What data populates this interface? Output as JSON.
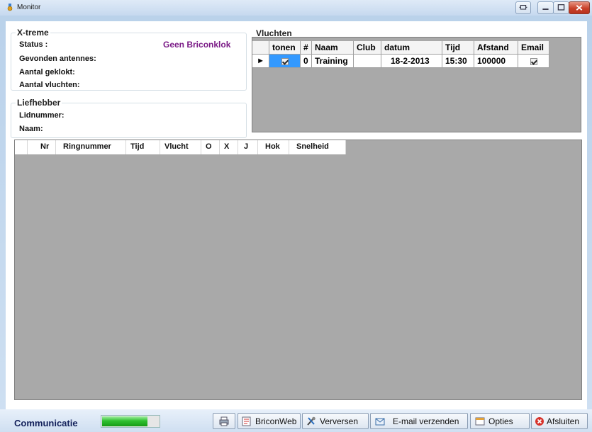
{
  "window": {
    "title": "Monitor"
  },
  "xtreme": {
    "title": "X-treme",
    "status_label": "Status :",
    "status_value": "Geen Briconklok",
    "antennas_label": "Gevonden antennes:",
    "clocked_label": "Aantal geklokt:",
    "flights_label": "Aantal vluchten:"
  },
  "liefhebber": {
    "title": "Liefhebber",
    "member_label": "Lidnummer:",
    "name_label": "Naam:"
  },
  "vluchten": {
    "title": "Vluchten",
    "columns": [
      "tonen",
      "#",
      "Naam",
      "Club",
      "datum",
      "Tijd",
      "Afstand",
      "Email"
    ],
    "rows": [
      {
        "tonen": true,
        "nr": "0",
        "naam": "Training",
        "club": "",
        "datum": "18-2-2013",
        "tijd": "15:30",
        "afstand": "100000",
        "email": true
      }
    ]
  },
  "birds_grid": {
    "columns": [
      "Nr",
      "Ringnummer",
      "Tijd",
      "Vlucht",
      "O",
      "X",
      "J",
      "Hok",
      "Snelheid"
    ]
  },
  "bottom": {
    "comm_label": "Communicatie",
    "progress_fraction": 0.8,
    "buttons": {
      "print": "",
      "briconweb": "BriconWeb",
      "refresh": "Verversen",
      "email": "E-mail verzenden",
      "options": "Opties",
      "close": "Afsluiten"
    }
  },
  "colors": {
    "status_value": "#7a1a86",
    "selection": "#3399ff",
    "progress": "#2fc02f"
  }
}
